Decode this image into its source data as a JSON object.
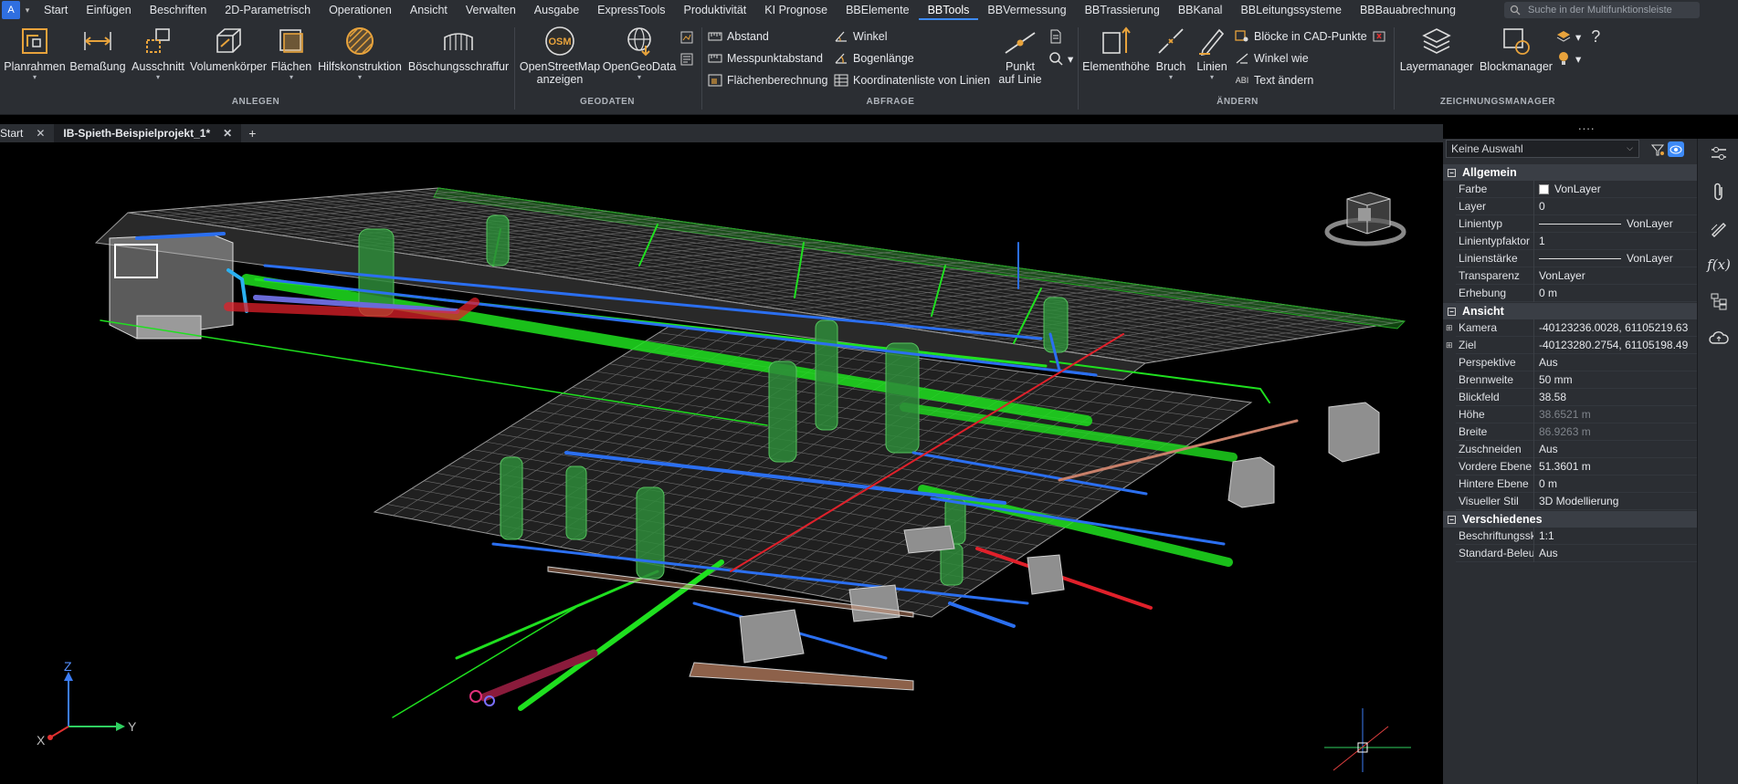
{
  "menubar": {
    "logo": "A",
    "tabs": [
      "Start",
      "Einfügen",
      "Beschriften",
      "2D-Parametrisch",
      "Operationen",
      "Ansicht",
      "Verwalten",
      "Ausgabe",
      "ExpressTools",
      "Produktivität",
      "KI Prognose",
      "BBElemente",
      "BBTools",
      "BBVermessung",
      "BBTrassierung",
      "BBKanal",
      "BBLeitungssysteme",
      "BBBauabrechnung"
    ],
    "active": "BBTools",
    "search_placeholder": "Suche in der Multifunktionsleiste"
  },
  "ribbon": {
    "anlegen": {
      "label": "ANLEGEN",
      "buttons": [
        "Planrahmen",
        "Bemaßung",
        "Ausschnitt",
        "Volumenkörper",
        "Flächen",
        "Hilfskonstruktion",
        "Böschungsschraffur"
      ]
    },
    "geodaten": {
      "label": "GEODATEN",
      "osm_l1": "OpenStreetMap",
      "osm_l2": "anzeigen",
      "osm_badge": "OSM",
      "geo": "OpenGeoData"
    },
    "abfrage": {
      "label": "ABFRAGE",
      "items": [
        "Abstand",
        "Messpunktabstand",
        "Flächenberechnung",
        "Winkel",
        "Bogenlänge",
        "Koordinatenliste von Linien"
      ],
      "punkt_l1": "Punkt",
      "punkt_l2": "auf Linie"
    },
    "aendern": {
      "label": "ÄNDERN",
      "buttons": [
        "Elementhöhe",
        "Bruch",
        "Linien"
      ],
      "items": [
        "Blöcke in CAD-Punkte",
        "Winkel wie",
        "Text ändern"
      ],
      "abl": "ABI"
    },
    "zeichnungsmanager": {
      "label": "ZEICHNUNGSMANAGER",
      "buttons": [
        "Layermanager",
        "Blockmanager"
      ],
      "help": "?"
    }
  },
  "doc_tabs": {
    "tabs": [
      "Start",
      "IB-Spieth-Beispielprojekt_1*"
    ],
    "add": "+",
    "more": "...."
  },
  "axes": {
    "z": "Z",
    "y": "Y",
    "x": "X"
  },
  "props": {
    "selection": "Keine Auswahl",
    "sections": [
      {
        "title": "Allgemein",
        "rows": [
          [
            "Farbe",
            "VonLayer"
          ],
          [
            "Layer",
            "0"
          ],
          [
            "Linientyp",
            "VonLayer"
          ],
          [
            "Linientypfaktor",
            "1"
          ],
          [
            "Linienstärke",
            "VonLayer"
          ],
          [
            "Transparenz",
            "VonLayer"
          ],
          [
            "Erhebung",
            "0 m"
          ]
        ]
      },
      {
        "title": "Ansicht",
        "rows": [
          [
            "Kamera",
            "-40123236.0028, 61105219.63"
          ],
          [
            "Ziel",
            "-40123280.2754, 61105198.49"
          ],
          [
            "Perspektive",
            "Aus"
          ],
          [
            "Brennweite",
            "50 mm"
          ],
          [
            "Blickfeld",
            "38.58"
          ],
          [
            "Höhe",
            "38.6521 m"
          ],
          [
            "Breite",
            "86.9263 m"
          ],
          [
            "Zuschneiden",
            "Aus"
          ],
          [
            "Vordere Ebene",
            "51.3601 m"
          ],
          [
            "Hintere Ebene",
            "0 m"
          ],
          [
            "Visueller Stil",
            "3D Modellierung"
          ]
        ]
      },
      {
        "title": "Verschiedenes",
        "rows": [
          [
            "Beschriftungssk",
            "1:1"
          ],
          [
            "Standard-Beleu",
            "Aus"
          ]
        ]
      }
    ]
  },
  "right_strip": {
    "fx_label": "f(x)"
  },
  "colors": {
    "accent": "#3d8af7",
    "pipe_green": "#1fe01f",
    "pipe_blue": "#2b6ff0",
    "pipe_red": "#e0202a",
    "grid": "#bfbfbf"
  }
}
